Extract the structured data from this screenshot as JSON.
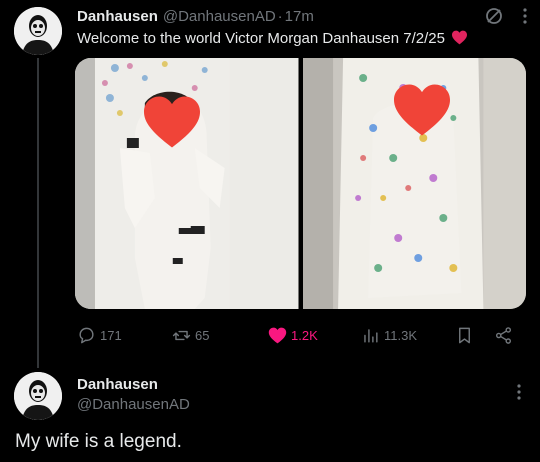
{
  "tweet1": {
    "display_name": "Danhausen",
    "handle": "@DanhausenAD",
    "separator": "·",
    "time": "17m",
    "text": "Welcome to the world Victor Morgan Danhausen 7/2/25",
    "emoji": "heart-emoji",
    "icons": {
      "grok": "slash-circle-icon",
      "more": "more-vertical-icon"
    },
    "actions": {
      "replies": "171",
      "reposts": "65",
      "likes": "1.2K",
      "views": "11.3K"
    },
    "colors": {
      "like": "#f91880",
      "muted": "#71767b",
      "heart": "#e0245e"
    }
  },
  "tweet2": {
    "display_name": "Danhausen",
    "handle": "@DanhausenAD",
    "text": "My wife is a legend."
  }
}
